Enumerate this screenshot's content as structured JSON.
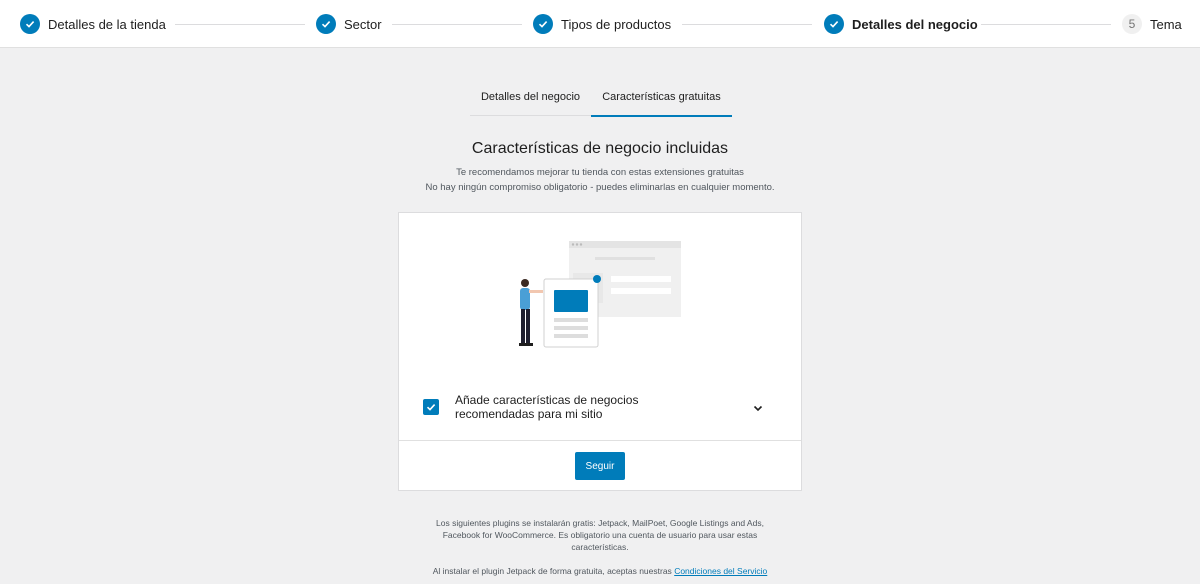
{
  "stepper": {
    "steps": [
      {
        "label": "Detalles de la tienda",
        "state": "done"
      },
      {
        "label": "Sector",
        "state": "done"
      },
      {
        "label": "Tipos de productos",
        "state": "done"
      },
      {
        "label": "Detalles del negocio",
        "state": "current-done"
      },
      {
        "label": "Tema",
        "number": "5",
        "state": "todo"
      }
    ]
  },
  "tabs": [
    {
      "label": "Detalles del negocio",
      "active": false
    },
    {
      "label": "Características gratuitas",
      "active": true
    }
  ],
  "main": {
    "title": "Características de negocio incluidas",
    "subtitle_1": "Te recomendamos mejorar tu tienda con estas extensiones gratuitas",
    "subtitle_2": "No hay ningún compromiso obligatorio - puedes eliminarlas en cualquier momento."
  },
  "card": {
    "option_label": "Añade características de negocios recomendadas para mi sitio",
    "option_checked": true,
    "continue_label": "Seguir"
  },
  "footer": {
    "plugins_text": "Los siguientes plugins se instalarán gratis: Jetpack, MailPoet, Google Listings and Ads, Facebook for WooCommerce. Es obligatorio una cuenta de usuario para usar estas características.",
    "jetpack_text": "Al instalar el plugin Jetpack de forma gratuita, aceptas nuestras",
    "terms_link": "Condiciones del Servicio"
  },
  "colors": {
    "accent": "#007cba",
    "background": "#f0f0f1"
  }
}
